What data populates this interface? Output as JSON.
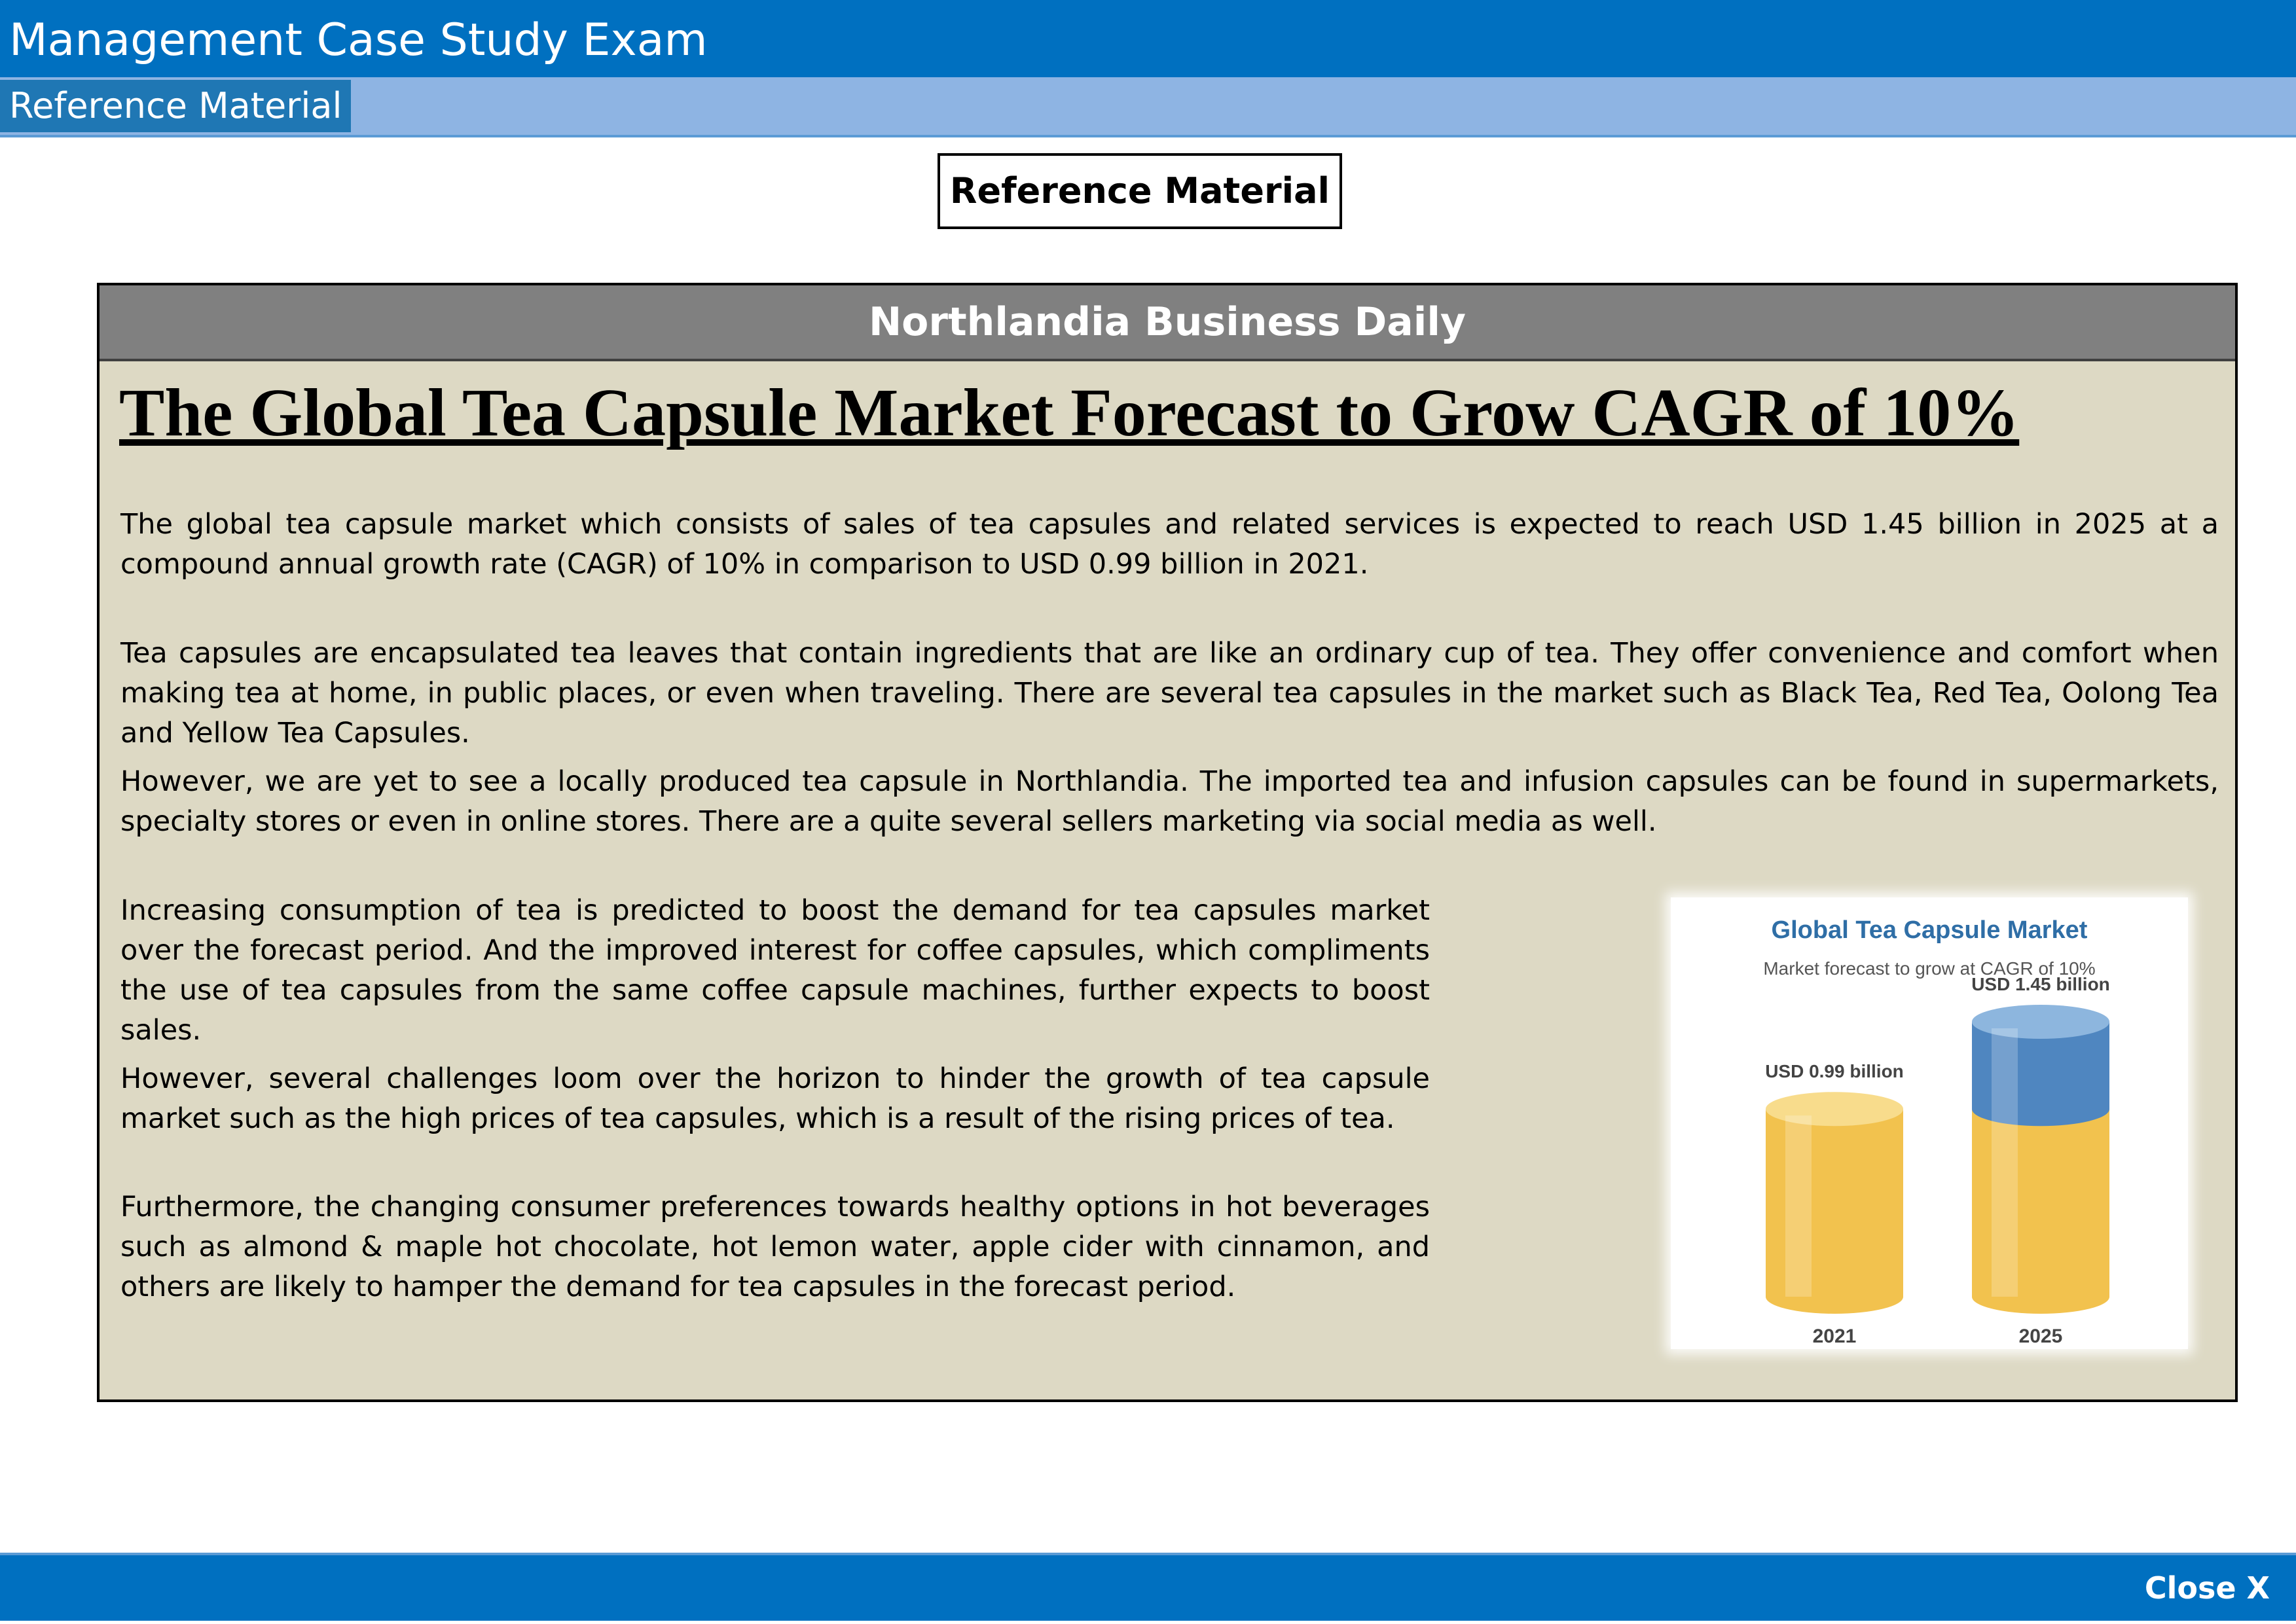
{
  "app": {
    "title": "Management Case Study Exam"
  },
  "tabs": [
    {
      "label": "Reference Material"
    }
  ],
  "page": {
    "heading": "Reference Material"
  },
  "article": {
    "publication": "Northlandia Business Daily",
    "headline": "The Global Tea Capsule Market Forecast to Grow CAGR of 10%",
    "paragraphs": [
      "The global tea capsule market which consists of sales of tea capsules and related services is expected to reach USD 1.45 billion in 2025 at a compound annual growth rate (CAGR) of 10% in comparison to USD 0.99 billion in 2021.",
      "Tea capsules are encapsulated tea leaves that contain ingredients that are like an ordinary cup of tea. They offer convenience and comfort when making tea at home, in public places, or even when traveling. There are several tea capsules in the market such as Black Tea, Red Tea, Oolong Tea and Yellow Tea Capsules.",
      "However, we are yet to see a locally produced tea capsule in Northlandia. The imported tea and infusion capsules can be found in supermarkets, specialty stores or even in online stores. There are a quite several sellers marketing via social media as well.",
      "Increasing consumption of tea is predicted to boost the demand for tea capsules market over the forecast period. And the improved interest for coffee capsules, which compliments the use of tea capsules from the same coffee capsule machines, further expects to boost sales.",
      "However, several challenges loom over the horizon to hinder the growth of tea capsule market such as the high prices of tea capsules, which is a result of the rising prices of tea.",
      "Furthermore, the changing consumer preferences towards healthy options in hot beverages such as almond & maple hot chocolate, hot lemon water, apple cider with cinnamon, and others are likely to hamper the demand for tea capsules in the forecast period."
    ]
  },
  "figure": {
    "chart_data": {
      "type": "bar",
      "title": "Global Tea Capsule Market",
      "subtitle": "Market forecast to grow at CAGR of 10%",
      "categories": [
        "2021",
        "2025"
      ],
      "values": [
        0.99,
        1.45
      ],
      "data_labels": [
        "USD 0.99 billion",
        "USD 1.45 billion"
      ],
      "ylabel": "",
      "xlabel": "",
      "grid": false,
      "colors": {
        "base": "#F2C24E",
        "growth": "#4F86C0",
        "title": "#2F6EA6",
        "subtitle": "#555555",
        "label": "#444444"
      }
    }
  },
  "footer": {
    "close_label": "Close X"
  }
}
